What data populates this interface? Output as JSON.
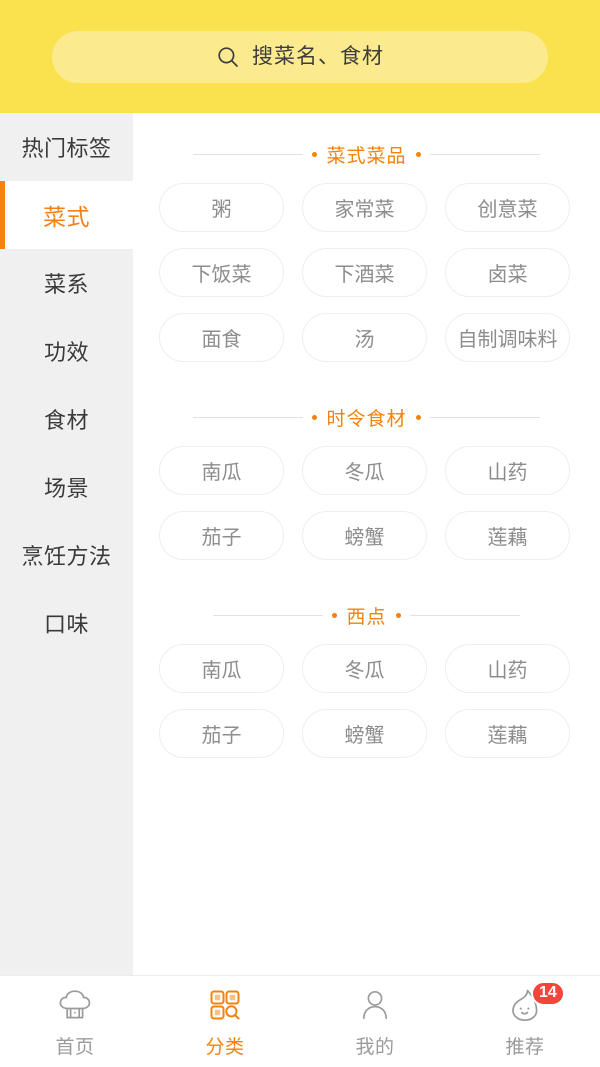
{
  "header": {
    "search": {
      "placeholder": "搜菜名、食材",
      "value": "",
      "icon": "search-icon"
    },
    "bg_color": "#f9e24e",
    "field_color": "#fbeb8e"
  },
  "sidebar": {
    "active_index": 1,
    "accent_color": "#f5820a",
    "items": [
      {
        "label": "热门标签"
      },
      {
        "label": "菜式"
      },
      {
        "label": "菜系"
      },
      {
        "label": "功效"
      },
      {
        "label": "食材"
      },
      {
        "label": "场景"
      },
      {
        "label": "烹饪方法"
      },
      {
        "label": "口味"
      }
    ]
  },
  "content": {
    "sections": [
      {
        "title": "菜式菜品",
        "tags": [
          {
            "label": "粥"
          },
          {
            "label": "家常菜"
          },
          {
            "label": "创意菜"
          },
          {
            "label": "下饭菜"
          },
          {
            "label": "下酒菜"
          },
          {
            "label": "卤菜"
          },
          {
            "label": "面食"
          },
          {
            "label": "汤"
          },
          {
            "label": "自制调味料"
          }
        ]
      },
      {
        "title": "时令食材",
        "tags": [
          {
            "label": "南瓜"
          },
          {
            "label": "冬瓜"
          },
          {
            "label": "山药"
          },
          {
            "label": "茄子"
          },
          {
            "label": "螃蟹"
          },
          {
            "label": "莲藕"
          }
        ]
      },
      {
        "title": "西点",
        "tags": [
          {
            "label": "南瓜"
          },
          {
            "label": "冬瓜"
          },
          {
            "label": "山药"
          },
          {
            "label": "茄子"
          },
          {
            "label": "螃蟹"
          },
          {
            "label": "莲藕"
          }
        ]
      }
    ]
  },
  "bottom_nav": {
    "active_index": 1,
    "active_color": "#f5820a",
    "inactive_color": "#9b9b9b",
    "badge_color": "#f4453c",
    "items": [
      {
        "label": "首页",
        "icon": "chef-hat-icon",
        "badge": ""
      },
      {
        "label": "分类",
        "icon": "category-grid-icon",
        "badge": ""
      },
      {
        "label": "我的",
        "icon": "person-icon",
        "badge": ""
      },
      {
        "label": "推荐",
        "icon": "flame-icon",
        "badge": "14"
      }
    ]
  }
}
